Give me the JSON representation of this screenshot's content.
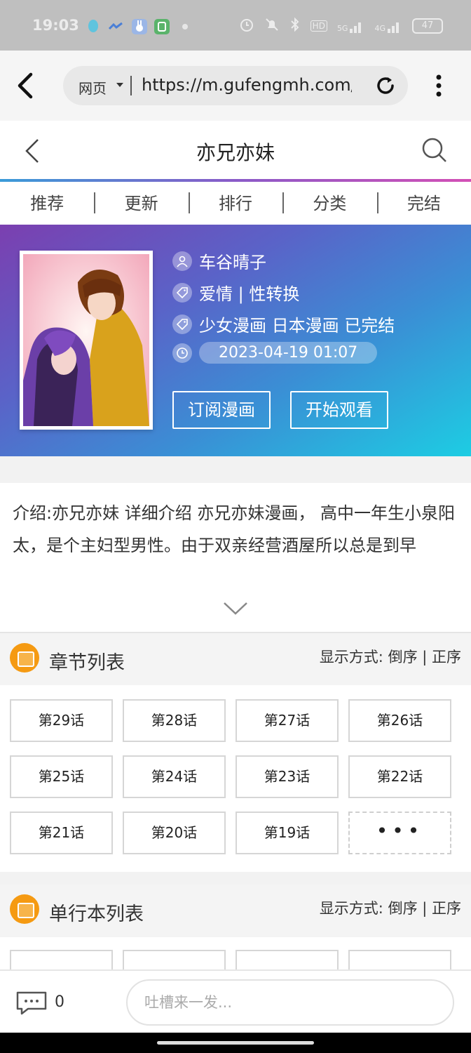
{
  "status_bar": {
    "time": "19:03",
    "battery": "47",
    "network_labels": [
      "HD",
      "5G",
      "4G"
    ],
    "icons": [
      "qq-icon",
      "bird-icon",
      "rabbit-icon",
      "wechat-icon",
      "alarm-icon",
      "mute-icon",
      "bluetooth-icon"
    ]
  },
  "browser": {
    "mode_label": "网页",
    "url": "https://m.gufengmh.com/"
  },
  "page_header": {
    "title": "亦兄亦妹"
  },
  "nav_tabs": [
    "推荐",
    "更新",
    "排行",
    "分类",
    "完结"
  ],
  "comic": {
    "author": "车谷晴子",
    "genres": "爱情 | 性转换",
    "tags": "少女漫画 日本漫画 已完结",
    "updated": "2023-04-19 01:07",
    "subscribe_label": "订阅漫画",
    "start_label": "开始观看"
  },
  "intro": {
    "text": "介绍:亦兄亦妹 详细介绍 亦兄亦妹漫画， 高中一年生小泉阳太，是个主妇型男性。由于双亲经营酒屋所以总是到早"
  },
  "chapter_section": {
    "title": "章节列表",
    "sort_label": "显示方式: 倒序 | 正序",
    "chapters": [
      "第29话",
      "第28话",
      "第27话",
      "第26话",
      "第25话",
      "第24话",
      "第23话",
      "第22话",
      "第21话",
      "第20话",
      "第19话"
    ],
    "more_label": "•••"
  },
  "volume_section": {
    "title": "单行本列表",
    "sort_label": "显示方式: 倒序 | 正序"
  },
  "bottom_bar": {
    "comment_count": "0",
    "comment_placeholder": "吐槽来一发..."
  },
  "colors": {
    "accent_orange": "#f59a12",
    "hero_gradient_start": "#7b3fb0",
    "hero_gradient_end": "#1dcde3"
  }
}
